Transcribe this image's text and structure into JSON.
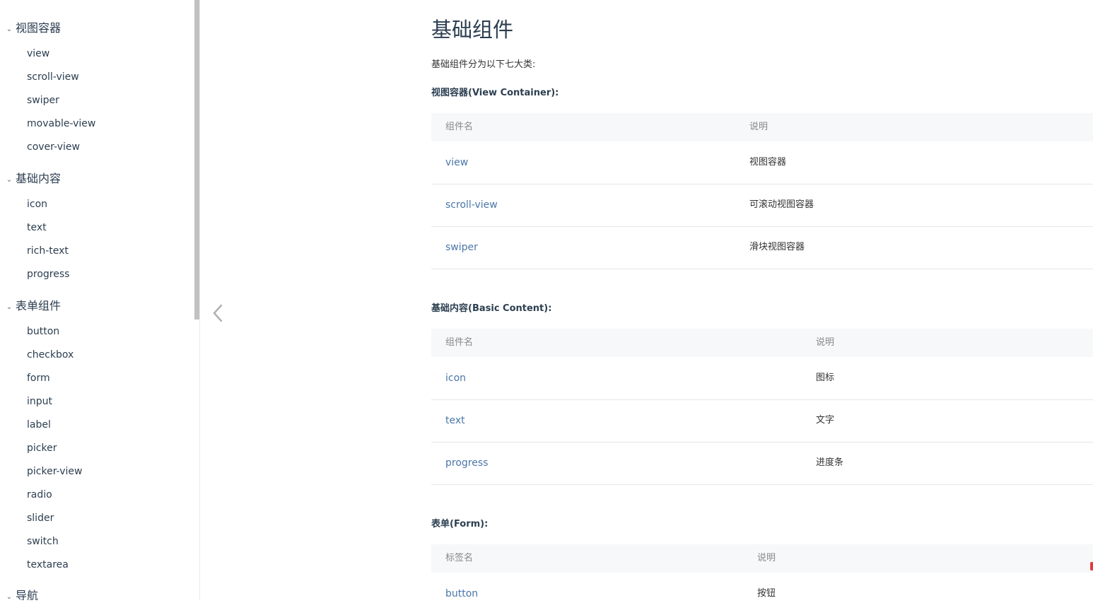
{
  "sidebar": {
    "groups": [
      {
        "title": "视图容器",
        "items": [
          "view",
          "scroll-view",
          "swiper",
          "movable-view",
          "cover-view"
        ]
      },
      {
        "title": "基础内容",
        "items": [
          "icon",
          "text",
          "rich-text",
          "progress"
        ]
      },
      {
        "title": "表单组件",
        "items": [
          "button",
          "checkbox",
          "form",
          "input",
          "label",
          "picker",
          "picker-view",
          "radio",
          "slider",
          "switch",
          "textarea"
        ]
      },
      {
        "title": "导航",
        "items": []
      }
    ]
  },
  "content": {
    "title": "基础组件",
    "intro": "基础组件分为以下七大类:",
    "sections": [
      {
        "heading": "视图容器(View Container):",
        "col1": "组件名",
        "col2": "说明",
        "rows": [
          {
            "name": "view",
            "desc": "视图容器"
          },
          {
            "name": "scroll-view",
            "desc": "可滚动视图容器"
          },
          {
            "name": "swiper",
            "desc": "滑块视图容器"
          }
        ]
      },
      {
        "heading": "基础内容(Basic Content):",
        "col1": "组件名",
        "col2": "说明",
        "rows": [
          {
            "name": "icon",
            "desc": "图标"
          },
          {
            "name": "text",
            "desc": "文字"
          },
          {
            "name": "progress",
            "desc": "进度条"
          }
        ]
      },
      {
        "heading": "表单(Form):",
        "col1": "标签名",
        "col2": "说明",
        "rows": [
          {
            "name": "button",
            "desc": "按钮"
          }
        ]
      }
    ]
  },
  "icons": {
    "group_chevron": "chevron-down-icon",
    "collapse": "chevron-left-icon"
  },
  "colors": {
    "link": "#4a76a8",
    "header_bg": "#f7f8fa",
    "accent_mark": "#e4393c"
  }
}
